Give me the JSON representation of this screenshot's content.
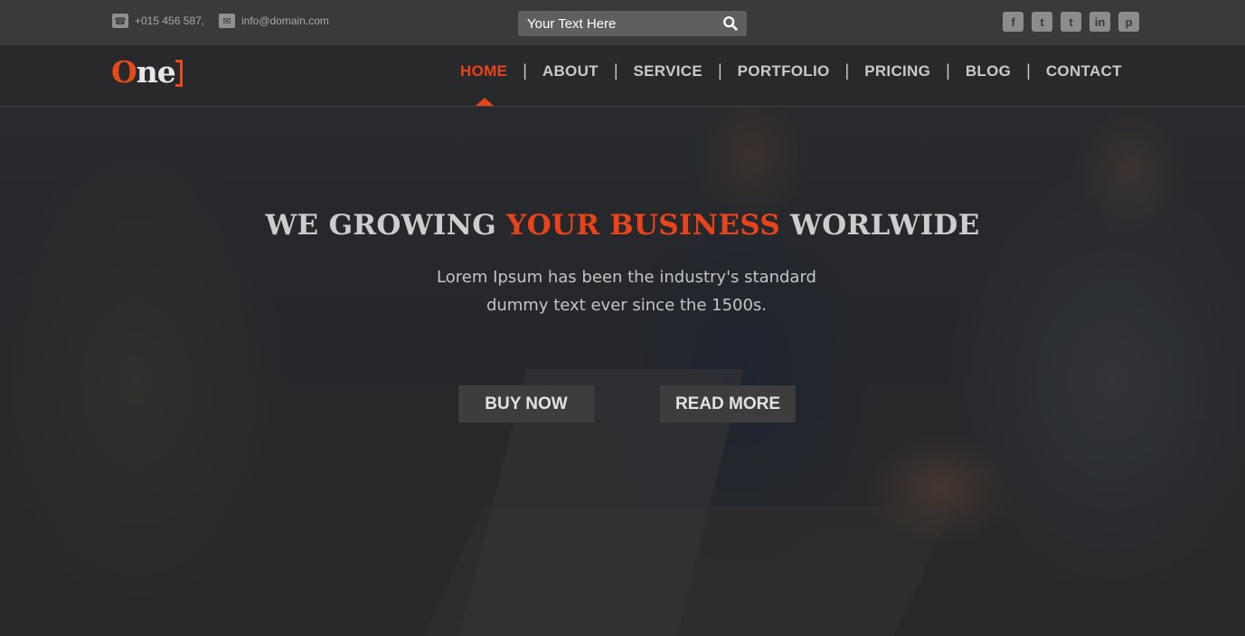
{
  "topbar": {
    "phone": "+015 456 587,",
    "email": "info@domain.com",
    "search_placeholder": "Your Text Here",
    "social": [
      {
        "icon": "facebook-icon",
        "glyph": "f"
      },
      {
        "icon": "twitter-icon",
        "glyph": "t"
      },
      {
        "icon": "twitter-icon",
        "glyph": "t"
      },
      {
        "icon": "linkedin-icon",
        "glyph": "in"
      },
      {
        "icon": "pinterest-icon",
        "glyph": "p"
      }
    ]
  },
  "brand": {
    "logo_first": "O",
    "logo_rest": "ne"
  },
  "nav": {
    "items": [
      "HOME",
      "ABOUT",
      "SERVICE",
      "PORTFOLIO",
      "PRICING",
      "BLOG",
      "CONTACT"
    ],
    "active": "HOME",
    "separator": "|"
  },
  "hero": {
    "headline_part1": "WE GROWING ",
    "headline_highlight": "YOUR BUSINESS",
    "headline_part2": " WORLWIDE",
    "subtitle_line1": "Lorem Ipsum has been the industry's standard",
    "subtitle_line2": "dummy text ever since the 1500s.",
    "buy_label": "BUY NOW",
    "read_label": "READ MORE"
  },
  "colors": {
    "accent": "#e8431a",
    "topbar_bg": "#3a3a3a",
    "button_bg": "#3d3d3d"
  }
}
